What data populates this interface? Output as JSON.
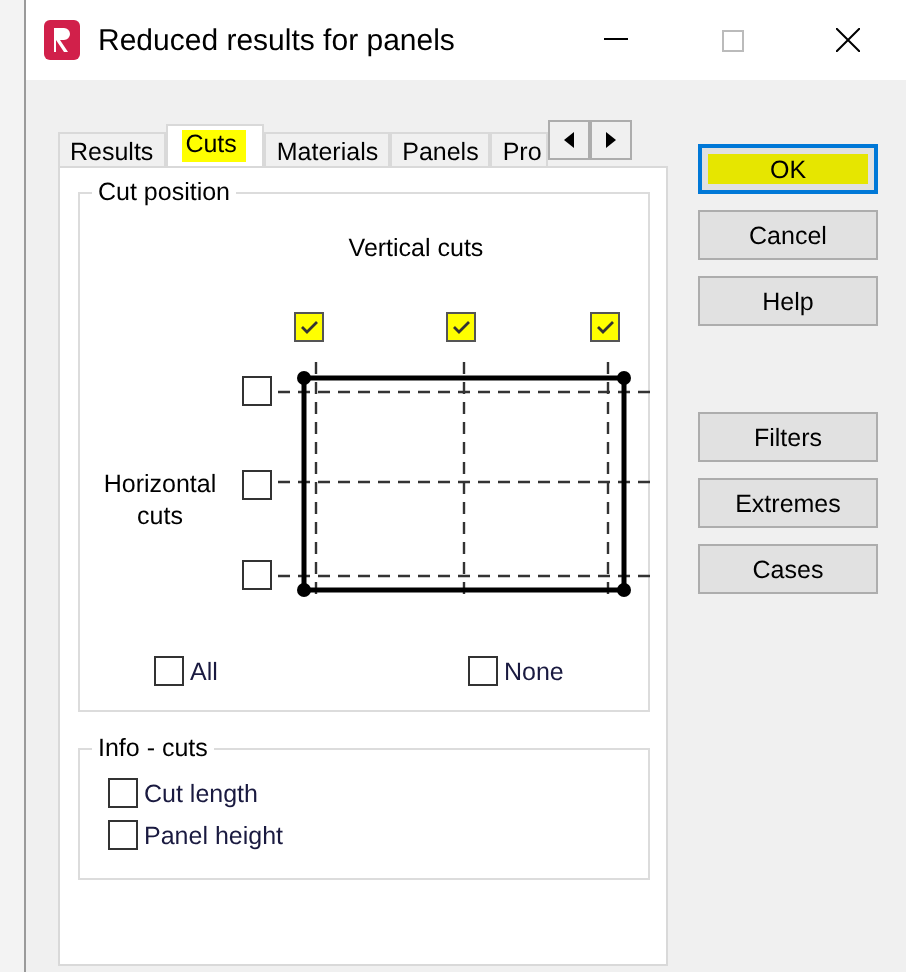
{
  "window": {
    "title": "Reduced results for panels"
  },
  "tabs": [
    {
      "label": "Results",
      "selected": false,
      "highlighted": false
    },
    {
      "label": "Cuts",
      "selected": true,
      "highlighted": true
    },
    {
      "label": "Materials",
      "selected": false,
      "highlighted": false
    },
    {
      "label": "Panels",
      "selected": false,
      "highlighted": false
    },
    {
      "label": "Pro",
      "selected": false,
      "highlighted": false
    }
  ],
  "cut_position": {
    "title": "Cut position",
    "vertical_label": "Vertical cuts",
    "horizontal_label": "Horizontal cuts",
    "vertical_cuts": [
      {
        "checked": true,
        "highlighted": true
      },
      {
        "checked": true,
        "highlighted": true
      },
      {
        "checked": true,
        "highlighted": true
      }
    ],
    "horizontal_cuts": [
      {
        "checked": false
      },
      {
        "checked": false
      },
      {
        "checked": false
      }
    ],
    "all": {
      "label": "All",
      "checked": false
    },
    "none": {
      "label": "None",
      "checked": false
    }
  },
  "info_cuts": {
    "title": "Info - cuts",
    "options": [
      {
        "label": "Cut length",
        "checked": false
      },
      {
        "label": "Panel height",
        "checked": false
      }
    ]
  },
  "buttons": [
    {
      "label": "OK",
      "default": true,
      "highlighted": true
    },
    {
      "label": "Cancel",
      "default": false,
      "highlighted": false
    },
    {
      "label": "Help",
      "default": false,
      "highlighted": false
    }
  ],
  "result_buttons": [
    {
      "label": "Filters",
      "default": false,
      "highlighted": false
    },
    {
      "label": "Extremes",
      "default": false,
      "highlighted": false
    },
    {
      "label": "Cases",
      "default": false,
      "highlighted": false
    }
  ]
}
